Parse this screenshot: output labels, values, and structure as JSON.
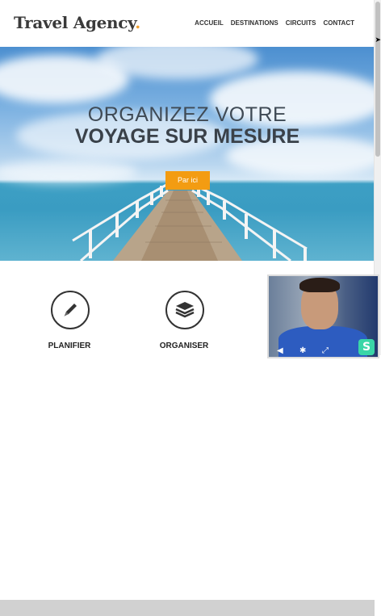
{
  "header": {
    "logo_text": "Travel Agency",
    "logo_dot": ".",
    "nav": [
      "ACCUEIL",
      "DESTINATIONS",
      "CIRCUITS",
      "CONTACT"
    ]
  },
  "hero": {
    "title_line1": "ORGANIZEZ VOTRE",
    "title_line2": "VOYAGE SUR MESURE",
    "cta_label": "Par ici"
  },
  "features": [
    {
      "icon": "pencil-icon",
      "label": "PLANIFIER"
    },
    {
      "icon": "layers-icon",
      "label": "ORGANISER"
    }
  ],
  "webcam": {
    "badge": "S",
    "controls": [
      "speaker-icon",
      "settings-icon",
      "fullscreen-icon"
    ]
  },
  "colors": {
    "accent": "#f39c12",
    "logo_dot": "#f0a030",
    "text_dark": "#3a4149"
  }
}
